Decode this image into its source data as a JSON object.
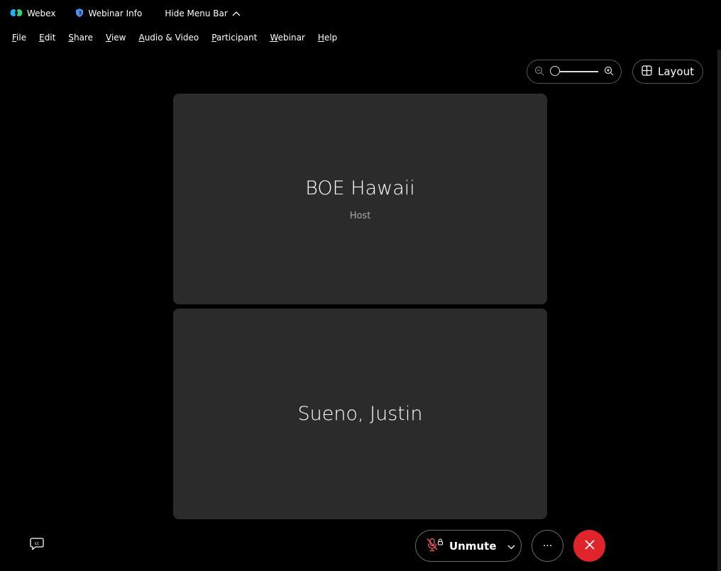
{
  "titlebar": {
    "app_name": "Webex",
    "info_label": "Webinar Info",
    "hide_label": "Hide Menu Bar"
  },
  "menu": [
    {
      "key": "F",
      "rest": "ile"
    },
    {
      "key": "E",
      "rest": "dit"
    },
    {
      "key": "S",
      "rest": "hare"
    },
    {
      "key": "V",
      "rest": "iew"
    },
    {
      "key": "A",
      "rest": "udio & Video"
    },
    {
      "key": "P",
      "rest": "articipant"
    },
    {
      "key": "W",
      "rest": "ebinar"
    },
    {
      "key": "H",
      "rest": "elp"
    }
  ],
  "toolbar": {
    "layout_label": "Layout",
    "zoom_level": 0
  },
  "tiles": [
    {
      "name": "BOE Hawaii",
      "role": "Host"
    },
    {
      "name": "Sueno, Justin",
      "role": ""
    }
  ],
  "controls": {
    "unmute_label": "Unmute",
    "more_label": "···"
  },
  "colors": {
    "end_button": "#e0242c",
    "tile_bg": "#2b2b2b",
    "shield": "#4f8fe8"
  },
  "icons": [
    "webex-logo-icon",
    "shield-icon",
    "chevron-up-icon",
    "zoom-out-icon",
    "zoom-in-icon",
    "layout-grid-icon",
    "closed-caption-icon",
    "microphone-muted-icon",
    "chevron-down-icon",
    "close-icon"
  ]
}
